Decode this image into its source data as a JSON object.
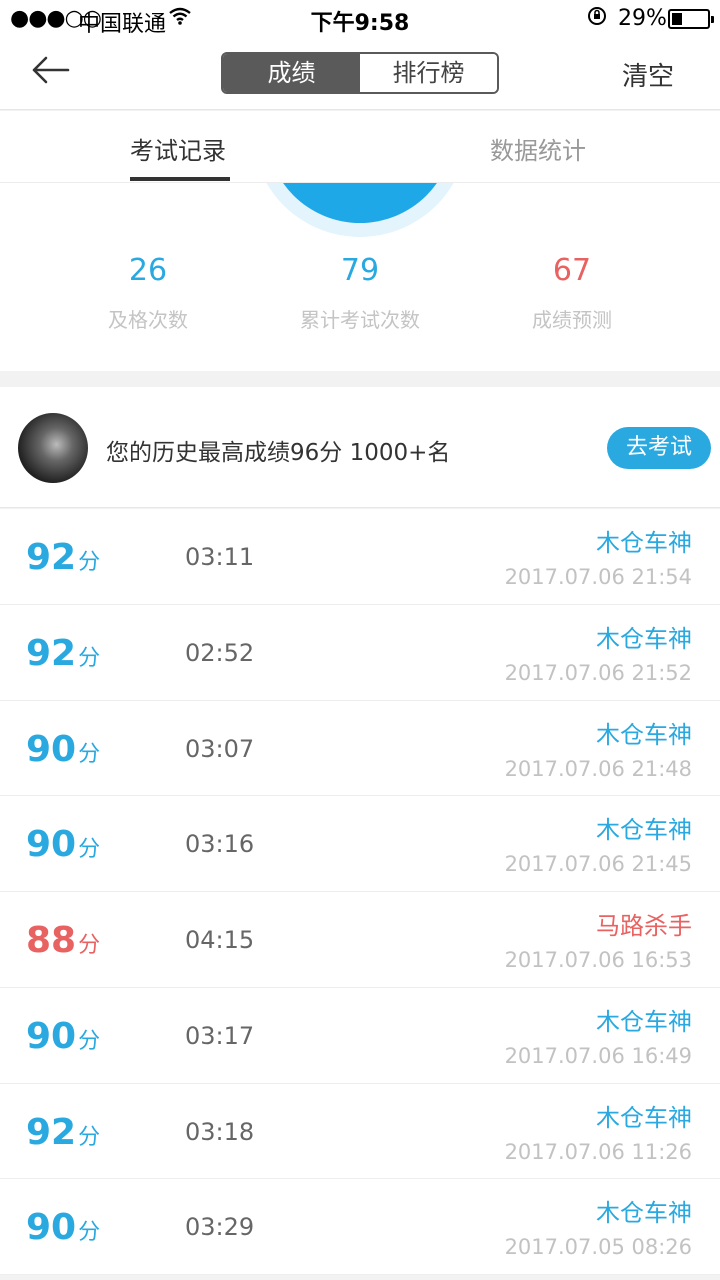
{
  "status_bar": {
    "signal": "●●●○○",
    "carrier": "中国联通",
    "time": "下午9:58",
    "battery_percent": "29%",
    "battery_level": 0.29
  },
  "nav": {
    "segments": [
      "成绩",
      "排行榜"
    ],
    "active_segment": 0,
    "clear_label": "清空"
  },
  "sub_tabs": [
    "考试记录",
    "数据统计"
  ],
  "stats": [
    {
      "value": "26",
      "label": "及格次数",
      "color": "#2aa9e0"
    },
    {
      "value": "79",
      "label": "累计考试次数",
      "color": "#2aa9e0"
    },
    {
      "value": "67",
      "label": "成绩预测",
      "color": "#e96262"
    }
  ],
  "banner": {
    "text": "您的历史最高成绩96分 1000+名",
    "button_label": "去考试"
  },
  "score_unit": "分",
  "records": [
    {
      "score": "92",
      "duration": "03:11",
      "title": "木仓车神",
      "date": "2017.07.06 21:54",
      "failed": false
    },
    {
      "score": "92",
      "duration": "02:52",
      "title": "木仓车神",
      "date": "2017.07.06 21:52",
      "failed": false
    },
    {
      "score": "90",
      "duration": "03:07",
      "title": "木仓车神",
      "date": "2017.07.06 21:48",
      "failed": false
    },
    {
      "score": "90",
      "duration": "03:16",
      "title": "木仓车神",
      "date": "2017.07.06 21:45",
      "failed": false
    },
    {
      "score": "88",
      "duration": "04:15",
      "title": "马路杀手",
      "date": "2017.07.06 16:53",
      "failed": true
    },
    {
      "score": "90",
      "duration": "03:17",
      "title": "木仓车神",
      "date": "2017.07.06 16:49",
      "failed": false
    },
    {
      "score": "92",
      "duration": "03:18",
      "title": "木仓车神",
      "date": "2017.07.06 11:26",
      "failed": false
    },
    {
      "score": "90",
      "duration": "03:29",
      "title": "木仓车神",
      "date": "2017.07.05 08:26",
      "failed": false
    }
  ],
  "colors": {
    "accent": "#2aa9e0",
    "fail": "#e96262"
  }
}
